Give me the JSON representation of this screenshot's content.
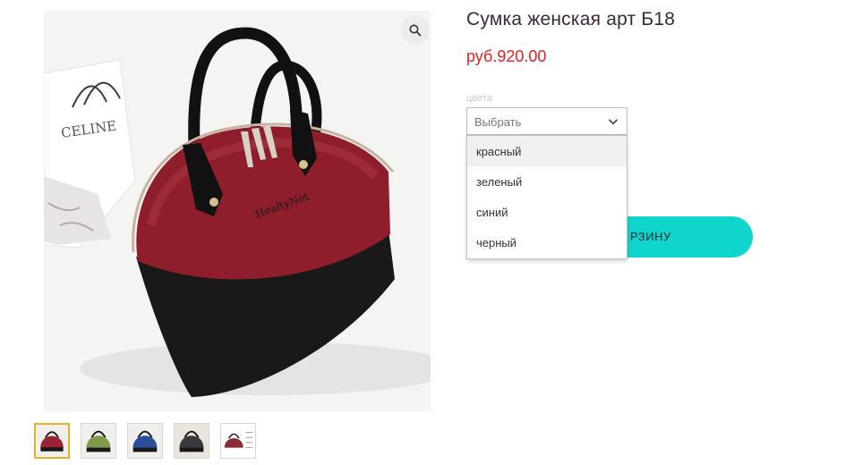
{
  "product": {
    "title": "Сумка женская арт Б18",
    "price": "руб.920.00",
    "brand_text": "HealtyNet",
    "backdrop_text": "CELINE"
  },
  "variation": {
    "label": "цвета",
    "placeholder": "Выбрать",
    "options": [
      "красный",
      "зеленый",
      "синий",
      "черный"
    ],
    "hovered_index": 0
  },
  "cart_button": {
    "label": "РЗИНУ"
  },
  "gallery": {
    "zoom_icon": "magnifier-icon",
    "thumbnails": [
      {
        "color": "#9b2233",
        "active": true
      },
      {
        "color": "#7f9a4c",
        "active": false
      },
      {
        "color": "#2a4f9c",
        "active": false
      },
      {
        "color": "#3a3a3a",
        "active": false
      },
      {
        "color": "#8a2a32",
        "active": false
      }
    ]
  },
  "colors": {
    "accent": "#10d5cd",
    "price": "#e02323",
    "thumb_active": "#e3b522"
  }
}
